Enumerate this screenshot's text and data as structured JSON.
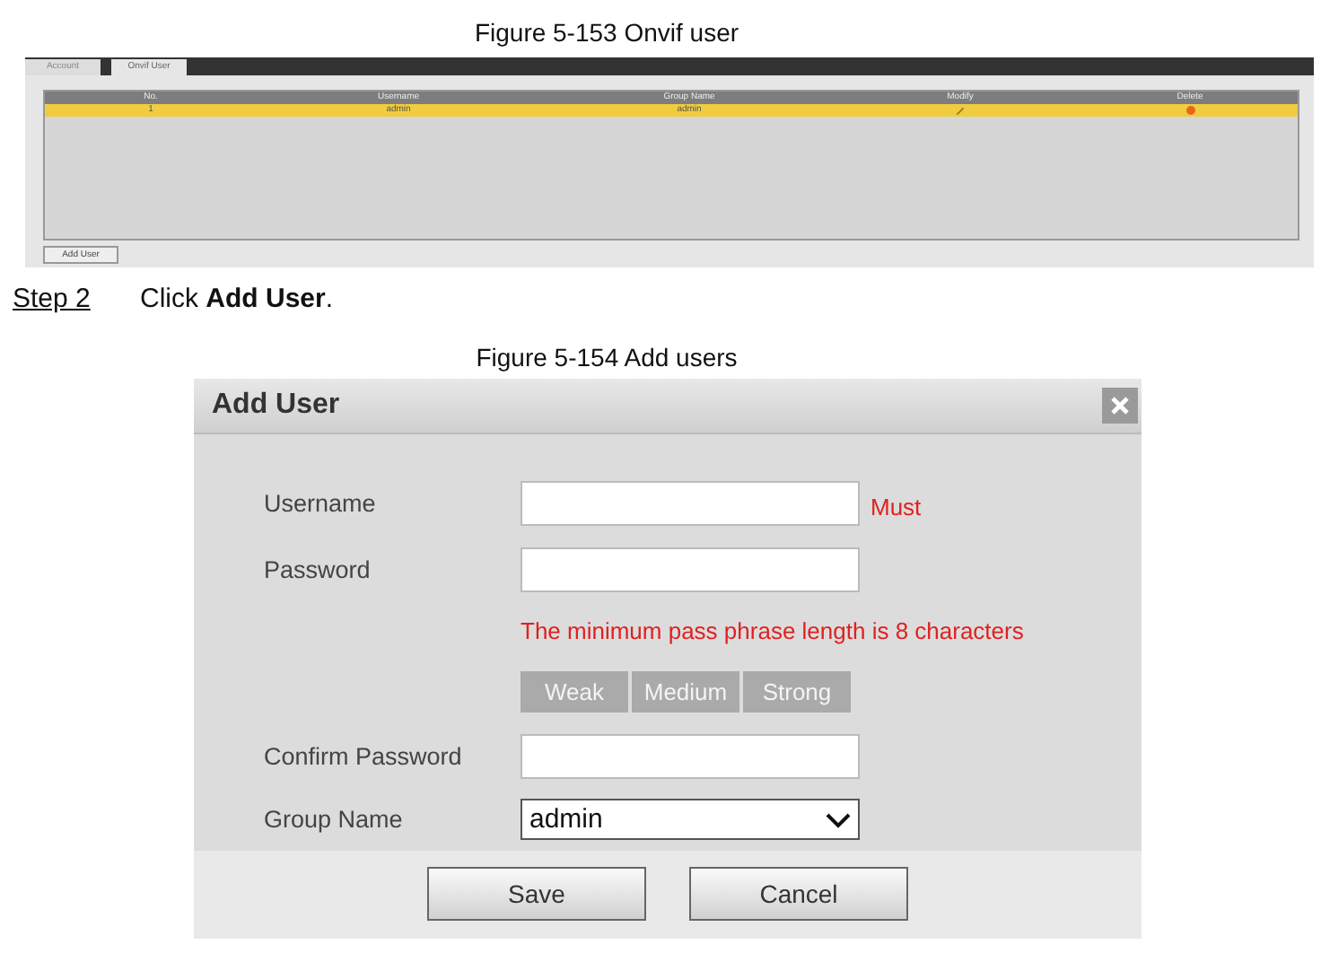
{
  "figure_1": {
    "caption": "Figure 5-153 Onvif user",
    "tabs": [
      {
        "label": "Account",
        "selected": false
      },
      {
        "label": "Onvif User",
        "selected": true
      }
    ],
    "table": {
      "columns": [
        "No.",
        "Username",
        "Group Name",
        "Modify",
        "Delete"
      ],
      "rows": [
        {
          "cells": [
            "1",
            "admin",
            "admin"
          ],
          "selected": true
        }
      ]
    },
    "add_button": "Add User"
  },
  "step": {
    "number": "Step 2",
    "text": "Click **Add User**."
  },
  "figure_2": {
    "caption": "Figure 5-154 Add users",
    "dialog": {
      "title": "Add User",
      "rows": [
        {
          "kind": "input",
          "label": "Username",
          "note": "Must"
        },
        {
          "kind": "input",
          "label": "Password"
        },
        {
          "kind": "message",
          "text": "The minimum pass phrase length is 8 characters"
        },
        {
          "kind": "strength",
          "segments": [
            "Weak",
            "Medium",
            "Strong"
          ]
        },
        {
          "kind": "input",
          "label": "Confirm Password"
        },
        {
          "kind": "select",
          "label": "Group Name",
          "value": "admin"
        }
      ],
      "buttons": [
        "Save",
        "Cancel"
      ]
    }
  }
}
